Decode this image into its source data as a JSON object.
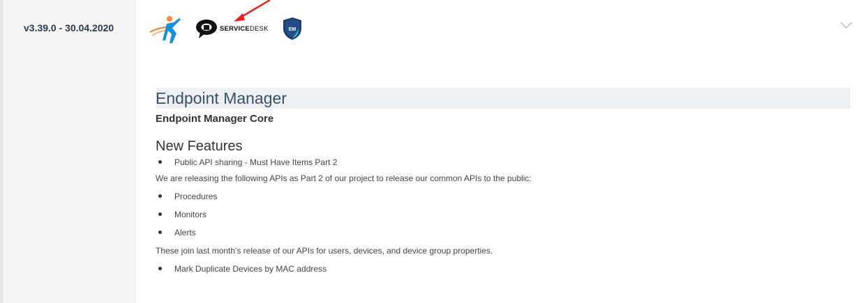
{
  "version": {
    "label": "v3.39.0 - 30.04.2020"
  },
  "logos": [
    {
      "icon": "runner-logo-icon"
    },
    {
      "icon": "servicedesk-logo-icon",
      "text_bold": "SERVICE",
      "text_regular": "DESK"
    },
    {
      "icon": "em-shield-icon",
      "text": "EM"
    }
  ],
  "annotation": {
    "icon": "red-arrow-icon",
    "color": "#e8231f"
  },
  "toggle": {
    "icon": "chevron-down-icon"
  },
  "article": {
    "title": "Endpoint Manager",
    "subtitle": "Endpoint Manager Core",
    "section": "New Features",
    "lines": [
      {
        "bullet": true,
        "text": "Public API sharing - Must Have Items Part 2"
      },
      {
        "bullet": false,
        "text": "We are releasing the following APIs as Part 2 of our project to release our common APIs to the public:"
      },
      {
        "bullet": true,
        "text": "Procedures"
      },
      {
        "bullet": true,
        "text": "Monitors"
      },
      {
        "bullet": true,
        "text": "Alerts"
      },
      {
        "bullet": false,
        "text": "These join last month's release of our APIs for users, devices, and device group properties."
      },
      {
        "bullet": true,
        "text": "Mark Duplicate Devices by MAC address"
      }
    ]
  },
  "colors": {
    "title": "#3a5068",
    "title_bg": "#eef1f4",
    "sidebar_bg": "#f5f5f5",
    "em_shield": "#1f3f6e"
  }
}
